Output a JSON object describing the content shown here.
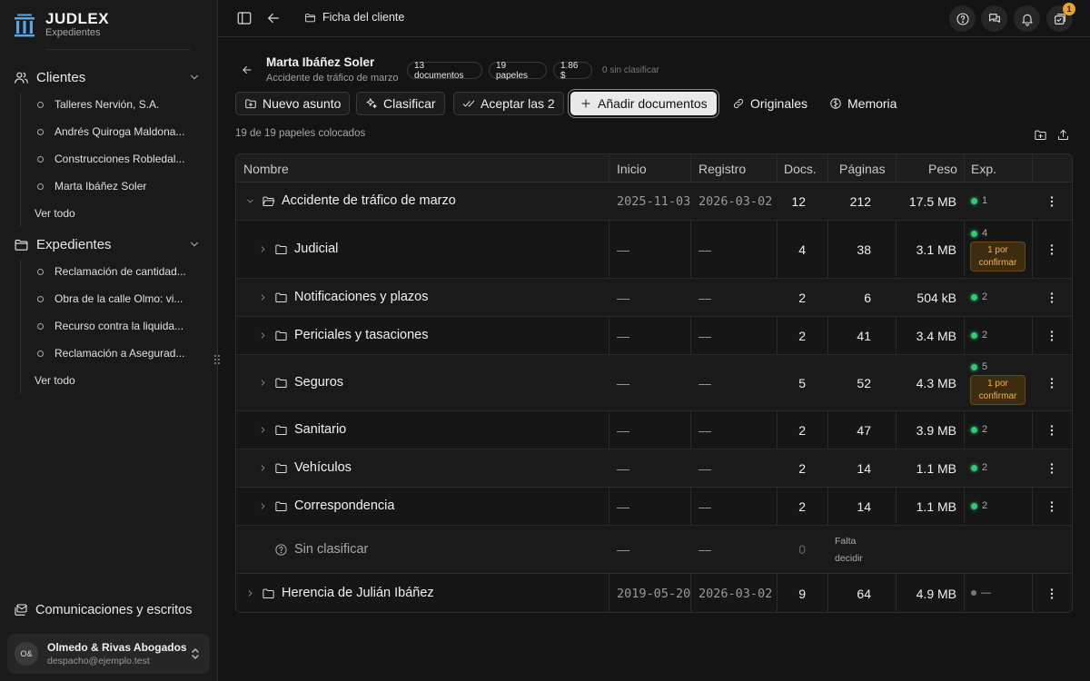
{
  "brand": {
    "name": "JUDLEX",
    "subtitle": "Expedientes"
  },
  "sidebar": {
    "clients_title": "Clientes",
    "clients": [
      "Talleres Nervión, S.A.",
      "Andrés Quiroga Maldona...",
      "Construcciones Robledal...",
      "Marta Ibáñez Soler"
    ],
    "clients_see_all": "Ver todo",
    "cases_title": "Expedientes",
    "cases": [
      "Reclamación de cantidad...",
      "Obra de la calle Olmo: vi...",
      "Recurso contra la liquida...",
      "Reclamación a Asegurad..."
    ],
    "cases_see_all": "Ver todo",
    "comms": "Comunicaciones y escritos",
    "account": {
      "initials": "O&",
      "name": "Olmedo & Rivas Abogados",
      "email": "despacho@ejemplo.test"
    }
  },
  "topbar": {
    "breadcrumb": "Ficha del cliente",
    "notifications": "1"
  },
  "header": {
    "client_name": "Marta Ibáñez Soler",
    "case": "Accidente de tráfico de marzo",
    "pills": [
      "13 documentos",
      "19 papeles",
      "1.86 $"
    ],
    "unclassified": "0 sin clasificar"
  },
  "actions": {
    "new_matter": "Nuevo asunto",
    "classify": "Clasificar",
    "accept": "Aceptar las 2",
    "add_docs": "Añadir documentos",
    "originals": "Originales",
    "memory": "Memoria"
  },
  "placed_status": "19 de 19 papeles colocados",
  "table": {
    "columns": [
      "Nombre",
      "Inicio",
      "Registro",
      "Docs.",
      "Páginas",
      "Peso",
      "Exp."
    ],
    "rows": [
      {
        "name": "Accidente de tráfico de marzo",
        "start": "2025-11-03",
        "reg": "2026-03-02",
        "docs": "12",
        "pages": "212",
        "size": "17.5 MB",
        "exp": "1"
      },
      {
        "name": "Judicial",
        "start": "—",
        "reg": "—",
        "docs": "4",
        "pages": "38",
        "size": "3.1 MB",
        "exp": "4",
        "confirm": "1 por confirmar"
      },
      {
        "name": "Notificaciones y plazos",
        "start": "—",
        "reg": "—",
        "docs": "2",
        "pages": "6",
        "size": "504 kB",
        "exp": "2"
      },
      {
        "name": "Periciales y tasaciones",
        "start": "—",
        "reg": "—",
        "docs": "2",
        "pages": "41",
        "size": "3.4 MB",
        "exp": "2"
      },
      {
        "name": "Seguros",
        "start": "—",
        "reg": "—",
        "docs": "5",
        "pages": "52",
        "size": "4.3 MB",
        "exp": "5",
        "confirm": "1 por confirmar"
      },
      {
        "name": "Sanitario",
        "start": "—",
        "reg": "—",
        "docs": "2",
        "pages": "47",
        "size": "3.9 MB",
        "exp": "2"
      },
      {
        "name": "Vehículos",
        "start": "—",
        "reg": "—",
        "docs": "2",
        "pages": "14",
        "size": "1.1 MB",
        "exp": "2"
      },
      {
        "name": "Correspondencia",
        "start": "—",
        "reg": "—",
        "docs": "2",
        "pages": "14",
        "size": "1.1 MB",
        "exp": "2"
      },
      {
        "name": "Sin clasificar",
        "start": "—",
        "reg": "—",
        "docs": "0",
        "pending": "Falta decidir"
      },
      {
        "name": "Herencia de Julián Ibáñez",
        "start": "2019-05-20",
        "reg": "2026-03-02",
        "docs": "9",
        "pages": "64",
        "size": "4.9 MB",
        "exp": "—"
      }
    ]
  }
}
